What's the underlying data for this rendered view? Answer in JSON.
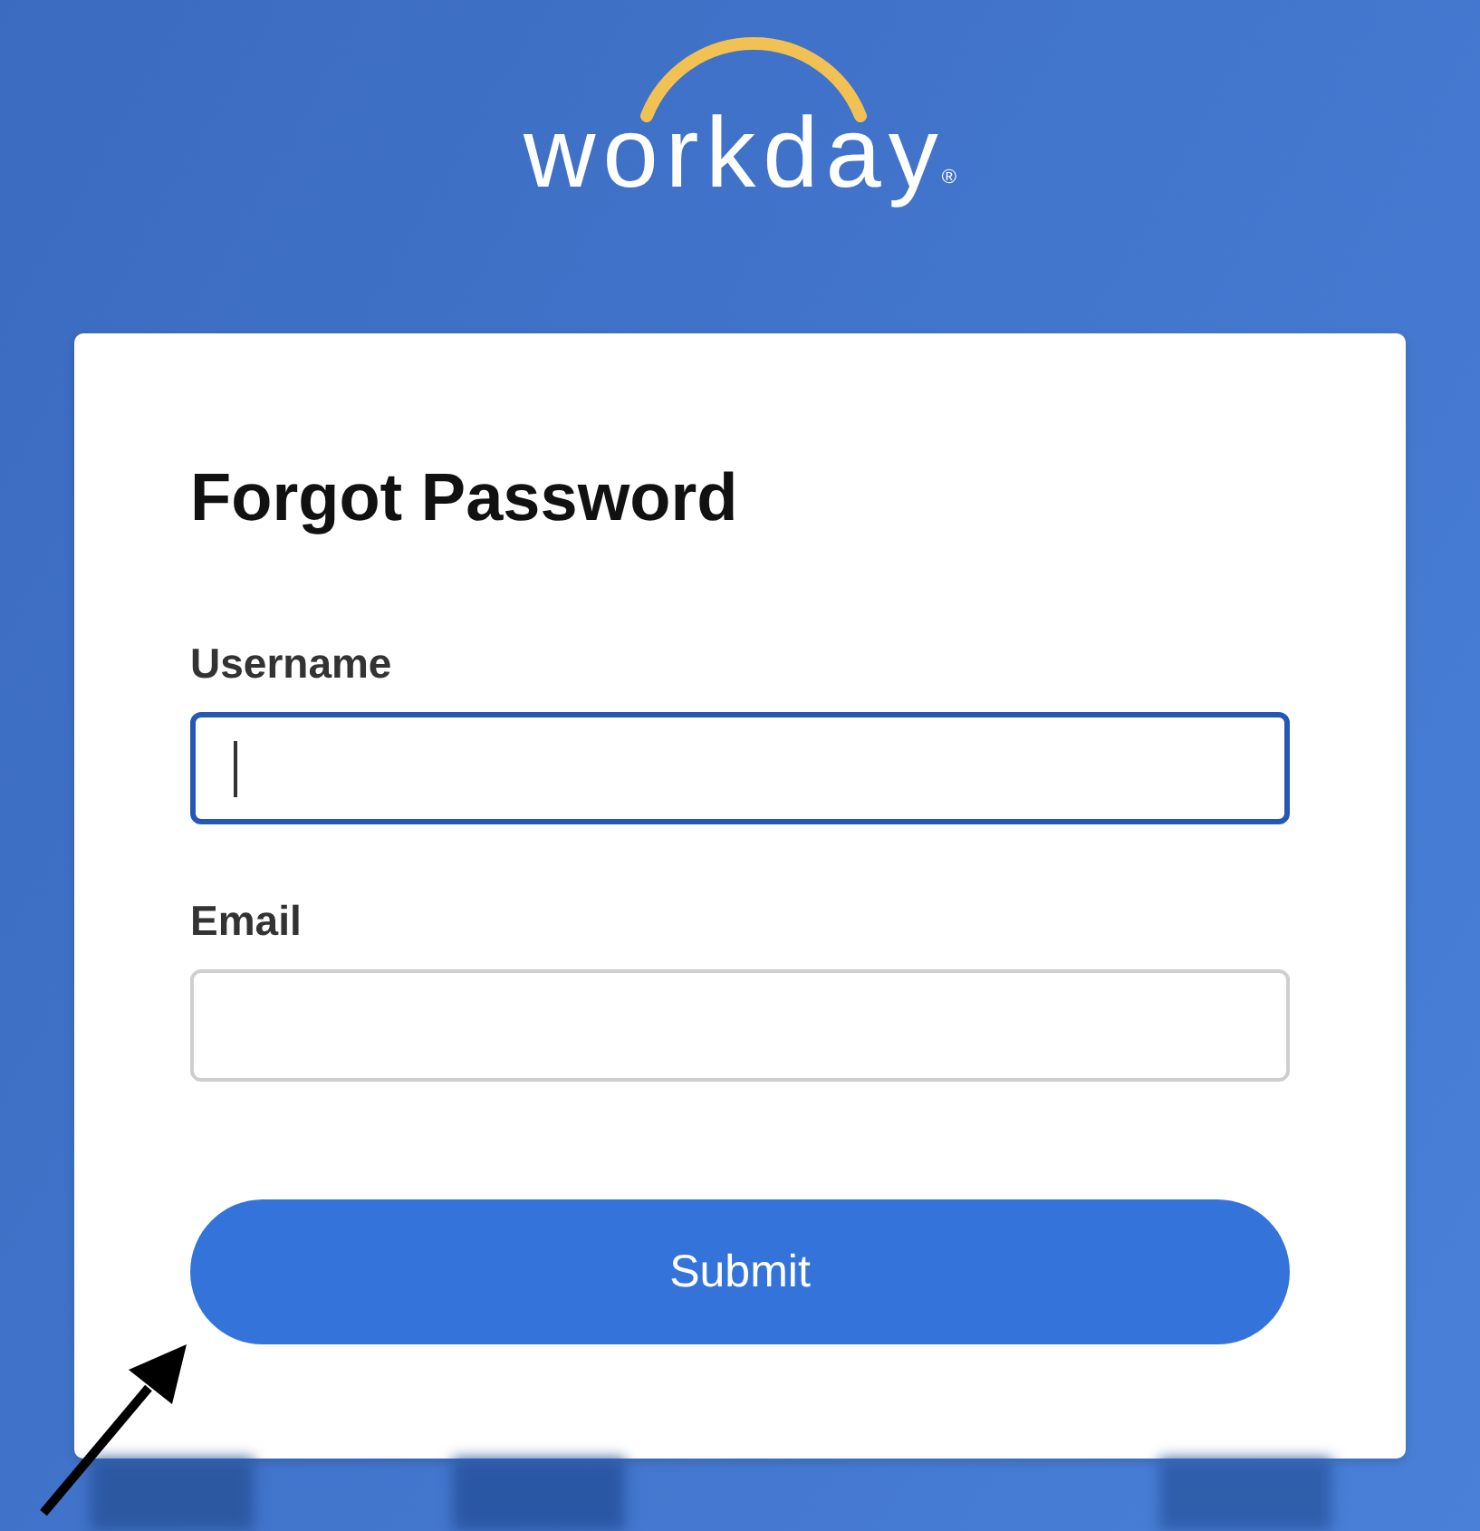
{
  "logo": {
    "wordmark": "workday",
    "mark": "®"
  },
  "form": {
    "title": "Forgot Password",
    "fields": [
      {
        "label": "Username",
        "focused": true
      },
      {
        "label": "Email",
        "focused": false
      }
    ],
    "submit_button": "Submit"
  },
  "annotations": [
    {
      "kind": "arrow"
    }
  ]
}
